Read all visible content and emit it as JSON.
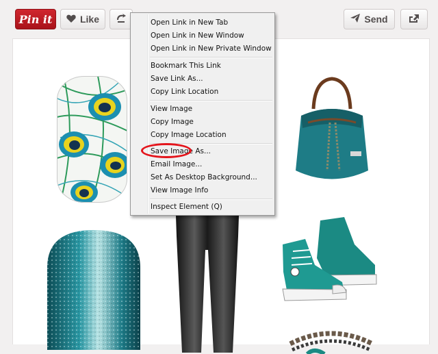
{
  "toolbar": {
    "pin_label": "Pin it",
    "like_label": "Like",
    "send_label": "Send"
  },
  "context_menu": {
    "items": [
      {
        "label": "Open Link in New Tab"
      },
      {
        "label": "Open Link in New Window"
      },
      {
        "label": "Open Link in New Private Window"
      },
      {
        "label": "Bookmark This Link"
      },
      {
        "label": "Save Link As..."
      },
      {
        "label": "Copy Link Location"
      },
      {
        "label": "View Image"
      },
      {
        "label": "Copy Image"
      },
      {
        "label": "Copy Image Location"
      },
      {
        "label": "Save Image As..."
      },
      {
        "label": "Email Image..."
      },
      {
        "label": "Set As Desktop Background..."
      },
      {
        "label": "View Image Info"
      },
      {
        "label": "Inspect Element (Q)"
      }
    ],
    "highlighted": "Save Image As...",
    "highlight_color": "#e4141b"
  },
  "colors": {
    "pin_red": "#bd1a20",
    "teal": "#1a7f86",
    "page_bg": "#f2f0f0"
  },
  "icons": [
    "heart-icon",
    "repin-icon",
    "send-plane-icon",
    "share-arrow-icon"
  ]
}
